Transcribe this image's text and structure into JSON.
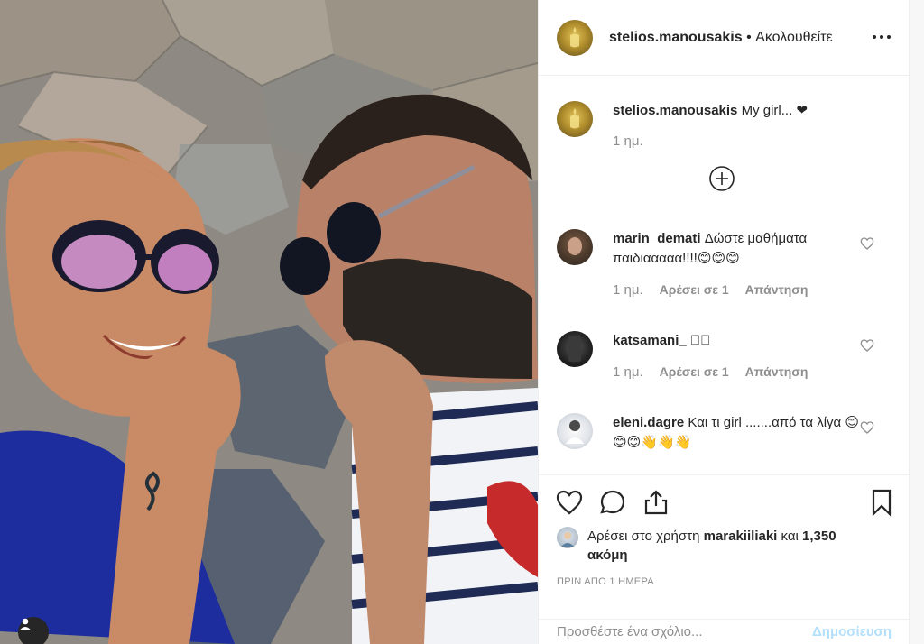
{
  "post": {
    "username": "stelios.manousakis",
    "separator": "•",
    "follow_label": "Ακολουθείτε"
  },
  "caption": {
    "username": "stelios.manousakis",
    "text": "My girl... ❤",
    "time": "1 ημ."
  },
  "comments": [
    {
      "username": "marin_demati",
      "text": "Δώστε μαθήματα παιδιααααα!!!!😊😊😊",
      "time": "1 ημ.",
      "likes": "Αρέσει σε 1",
      "reply": "Απάντηση"
    },
    {
      "username": "katsamani_",
      "text": "􀀀􀀀",
      "time": "1 ημ.",
      "likes": "Αρέσει σε 1",
      "reply": "Απάντηση"
    },
    {
      "username": "eleni.dagre",
      "text": "Και τι girl .......από τα λίγα 😊😊😊👋👋👋",
      "time": "",
      "likes": "",
      "reply": ""
    }
  ],
  "likes_line": {
    "prefix": "Αρέσει στο χρήστη",
    "user": "marakiiliaki",
    "conj": "και",
    "count": "1,350 ακόμη"
  },
  "timestamp": "ΠΡΙΝ ΑΠΟ 1 ΗΜΕΡΑ",
  "add_comment": {
    "placeholder": "Προσθέστε ένα σχόλιο...",
    "post_label": "Δημοσίευση"
  },
  "icons": {
    "more": "more-options-icon",
    "plus": "load-more-comments-icon",
    "like": "heart-icon",
    "comment": "comment-icon",
    "share": "share-icon",
    "save": "bookmark-icon",
    "tag": "user-tag-icon"
  },
  "colors": {
    "text": "#262626",
    "muted": "#8e8e8e",
    "border": "#efefef",
    "post_button_disabled": "#b2dffc"
  }
}
